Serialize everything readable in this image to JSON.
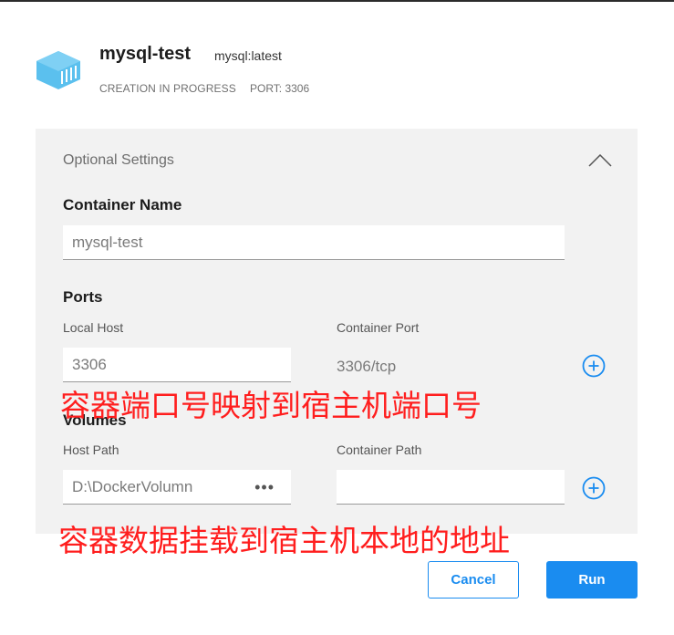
{
  "header": {
    "title": "mysql-test",
    "image_tag": "mysql:latest",
    "status": "CREATION IN PROGRESS",
    "port": "PORT: 3306",
    "icon": "container-icon"
  },
  "panel": {
    "title": "Optional Settings",
    "container_name": {
      "heading": "Container Name",
      "value": "mysql-test"
    },
    "ports": {
      "heading": "Ports",
      "local_host_label": "Local Host",
      "container_port_label": "Container Port",
      "local_host_value": "3306",
      "container_port_value": "3306/tcp"
    },
    "volumes": {
      "heading": "Volumes",
      "host_path_label": "Host Path",
      "container_path_label": "Container Path",
      "host_path_value": "D:\\DockerVolumn",
      "browse_label": "•••",
      "container_path_value": ""
    }
  },
  "annotations": {
    "ports_note": "容器端口号映射到宿主机端口号",
    "volumes_note": "容器数据挂载到宿主机本地的地址"
  },
  "buttons": {
    "cancel": "Cancel",
    "run": "Run"
  },
  "colors": {
    "accent": "#1a8cf0",
    "annotation": "#ff1e1e",
    "panel_bg": "#f2f2f2"
  }
}
